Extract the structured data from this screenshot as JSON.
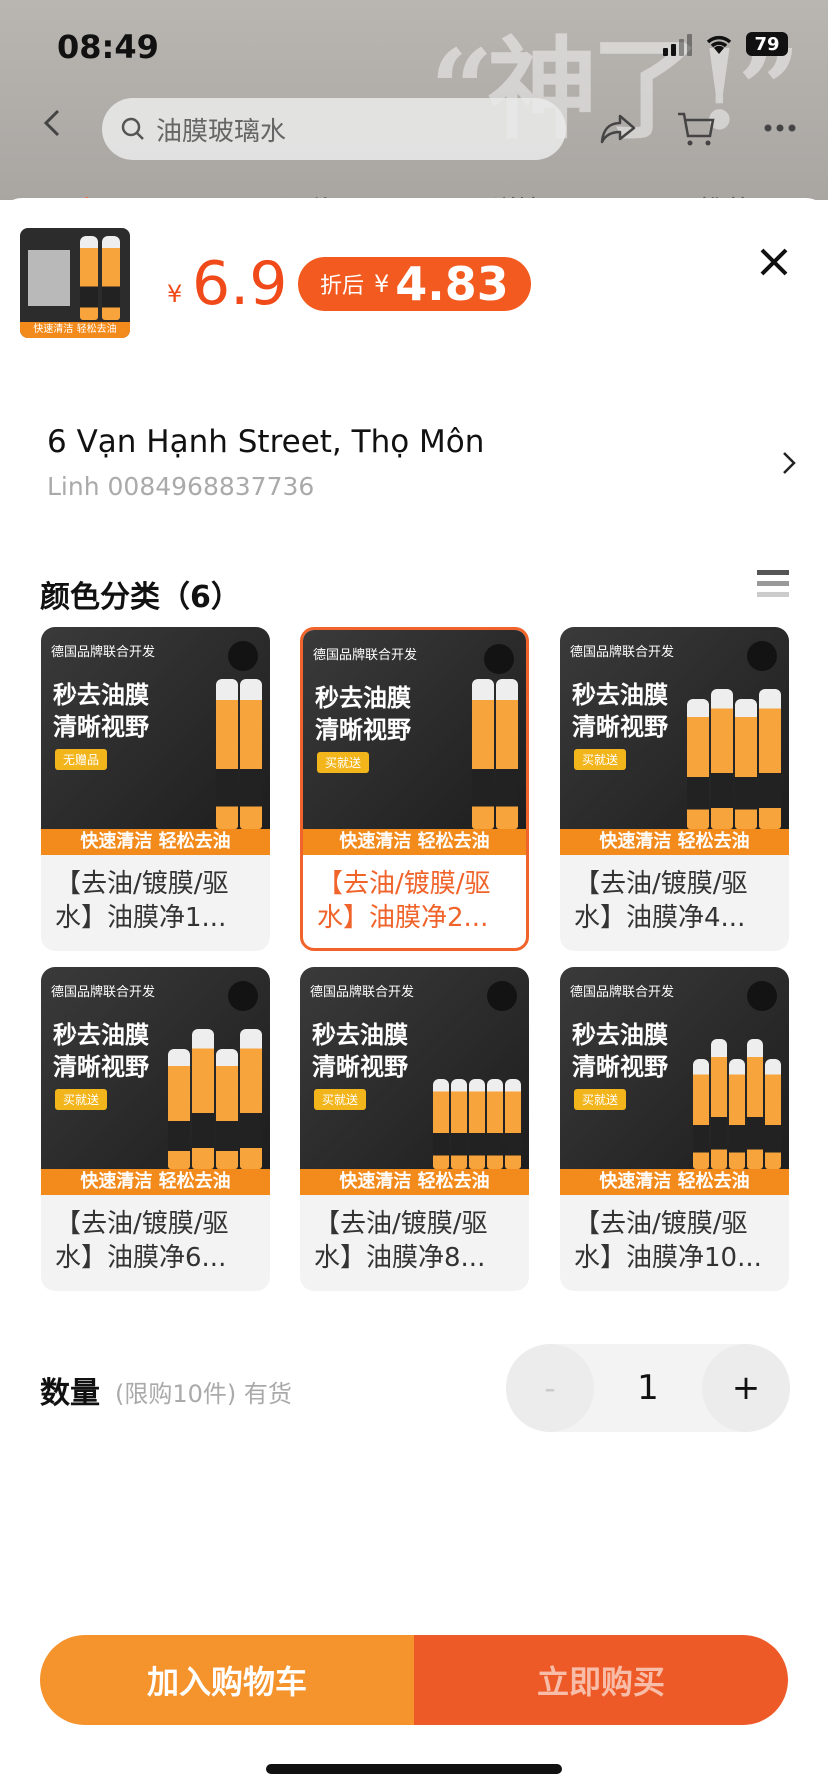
{
  "status": {
    "time": "08:49",
    "battery": "79"
  },
  "topbar": {
    "search_placeholder": "油膜玻璃水",
    "banner_text": "“神了!”"
  },
  "tabs_peek": [
    "商品",
    "评价",
    "详情",
    "推荐"
  ],
  "product": {
    "thumb_caption": "快速清洁 轻松去油",
    "price_symbol": "¥",
    "price": "6.9",
    "promo_label": "折后",
    "promo_symbol": "¥",
    "promo_price": "4.83"
  },
  "address": {
    "title": "6 Vạn Hạnh Street, Thọ Môn",
    "contact": "Linh 0084968837736"
  },
  "variants": {
    "section_title": "颜色分类（6）",
    "items": [
      {
        "name": "【去油/镀膜/驱水】油膜净1...",
        "header": "德国品牌联合开发",
        "headline1": "秒去油膜",
        "headline2": "清晰视野",
        "badge": "无赠品",
        "strip": "快速清洁 轻松去油"
      },
      {
        "name": "【去油/镀膜/驱水】油膜净2...",
        "header": "德国品牌联合开发",
        "headline1": "秒去油膜",
        "headline2": "清晰视野",
        "badge": "买就送",
        "strip": "快速清洁 轻松去油"
      },
      {
        "name": "【去油/镀膜/驱水】油膜净4...",
        "header": "德国品牌联合开发",
        "headline1": "秒去油膜",
        "headline2": "清晰视野",
        "badge": "买就送",
        "strip": "快速清洁 轻松去油"
      },
      {
        "name": "【去油/镀膜/驱水】油膜净6...",
        "header": "德国品牌联合开发",
        "headline1": "秒去油膜",
        "headline2": "清晰视野",
        "badge": "买就送",
        "strip": "快速清洁 轻松去油"
      },
      {
        "name": "【去油/镀膜/驱水】油膜净8...",
        "header": "德国品牌联合开发",
        "headline1": "秒去油膜",
        "headline2": "清晰视野",
        "badge": "买就送",
        "strip": "快速清洁 轻松去油"
      },
      {
        "name": "【去油/镀膜/驱水】油膜净10...",
        "header": "德国品牌联合开发",
        "headline1": "秒去油膜",
        "headline2": "清晰视野",
        "badge": "买就送",
        "strip": "快速清洁 轻松去油"
      }
    ]
  },
  "quantity": {
    "label": "数量",
    "note": "(限购10件) 有货",
    "minus": "-",
    "value": "1",
    "plus": "+"
  },
  "actions": {
    "add_to_cart": "加入购物车",
    "buy_now": "立即购买"
  },
  "colors": {
    "accent": "#f0632a",
    "cart": "#f5932c",
    "buy": "#ee5a27"
  }
}
